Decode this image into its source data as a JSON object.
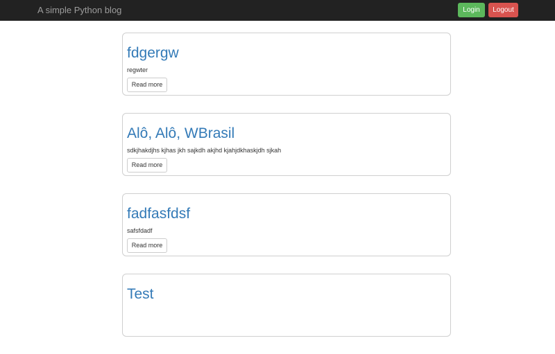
{
  "navbar": {
    "brand": "A simple Python blog",
    "login_label": "Login",
    "logout_label": "Logout"
  },
  "posts": [
    {
      "title": "fdgergw",
      "excerpt": "regwter",
      "button_label": "Read more"
    },
    {
      "title": "Alô, Alô, WBrasil",
      "excerpt": "sdkjhakdjhs kjhas jkh sajkdh akjhd kjahjdkhaskjdh sjkah",
      "button_label": "Read more"
    },
    {
      "title": "fadfasfdsf",
      "excerpt": "safsfdadf",
      "button_label": "Read more"
    },
    {
      "title": "Test",
      "excerpt": "",
      "button_label": ""
    }
  ],
  "colors": {
    "navbar_bg": "#222222",
    "link": "#337ab7",
    "login": "#5cb85c",
    "logout": "#d9534f"
  }
}
